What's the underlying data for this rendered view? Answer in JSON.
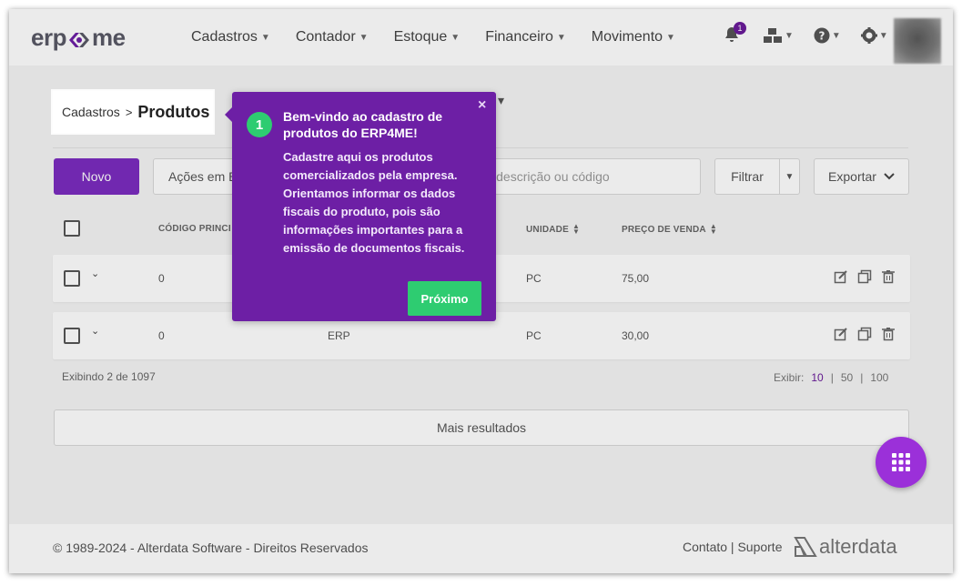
{
  "header": {
    "logo_left": "erp",
    "logo_right": "me",
    "nav": [
      {
        "label": "Cadastros"
      },
      {
        "label": "Contador"
      },
      {
        "label": "Estoque"
      },
      {
        "label": "Financeiro"
      },
      {
        "label": "Movimento"
      }
    ],
    "notifications_count": "1"
  },
  "breadcrumb": {
    "parent": "Cadastros",
    "separator": ">",
    "current": "Produtos"
  },
  "toolbar": {
    "new_label": "Novo",
    "bulk_actions_label": "Ações em B",
    "search_placeholder": "por descrição ou código",
    "filter_label": "Filtrar",
    "export_label": "Exportar"
  },
  "table": {
    "headers": [
      "CÓDIGO PRINCI",
      "UNIDADE",
      "PREÇO DE VENDA"
    ],
    "rows": [
      {
        "code": "0",
        "description": "",
        "unit": "PC",
        "price": "75,00"
      },
      {
        "code": "0",
        "description": "ERP",
        "unit": "PC",
        "price": "30,00"
      }
    ],
    "showing": "Exibindo 2 de 1097",
    "page_size_label": "Exibir:",
    "page_sizes": [
      "10",
      "50",
      "100"
    ],
    "more_results": "Mais resultados"
  },
  "tour": {
    "step": "1",
    "title": "Bem-vindo ao cadastro de produtos do ERP4ME!",
    "body": "Cadastre aqui os produtos comercializados pela empresa. Orientamos informar os dados fiscais do produto, pois são informações importantes para a emissão de documentos fiscais.",
    "close": "×",
    "next_label": "Próximo"
  },
  "footer": {
    "copyright": "© 1989-2024 - Alterdata Software - Direitos Reservados",
    "links": "Contato | Suporte",
    "brand": "alterdata"
  },
  "colors": {
    "primary": "#7b2cbf",
    "tour_bg": "#6d1fa5",
    "success": "#2ecc71",
    "fab": "#9b30d9"
  }
}
